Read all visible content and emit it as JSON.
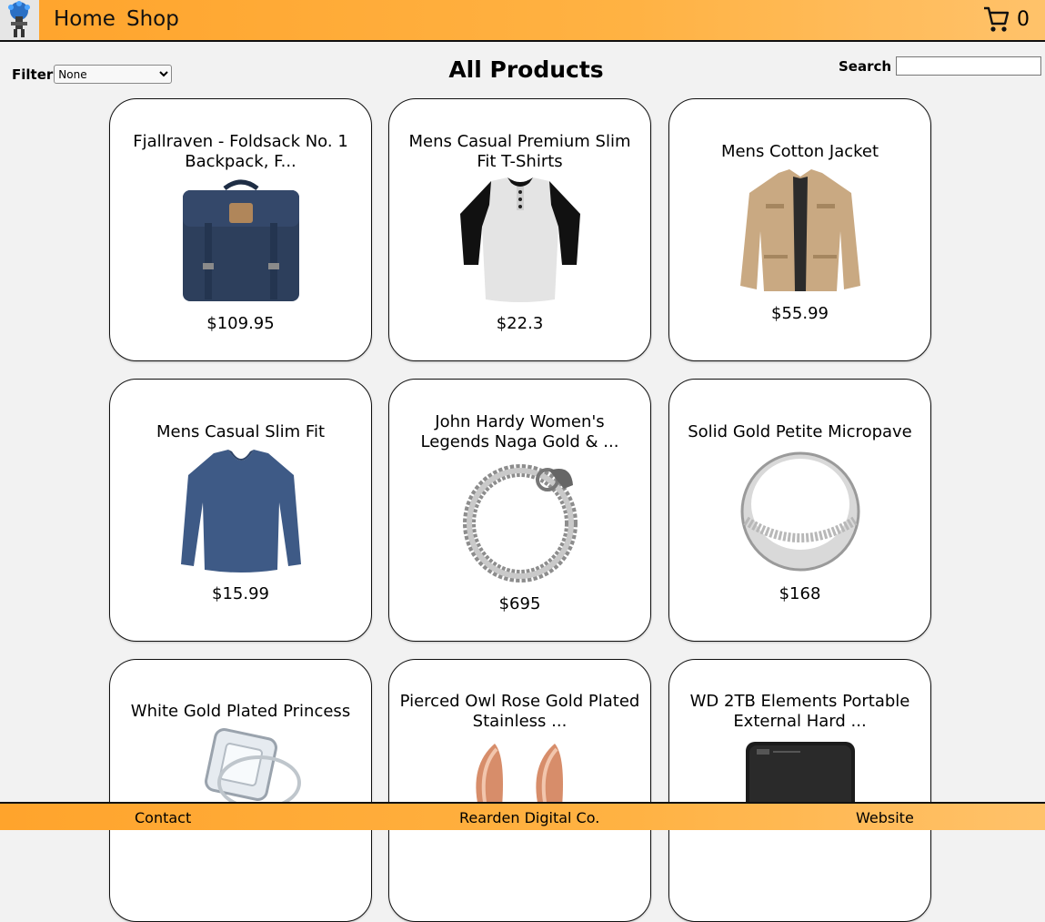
{
  "nav": {
    "home_label": "Home",
    "shop_label": "Shop",
    "cart_count": "0"
  },
  "toolbar": {
    "filter_label": "Filter",
    "filter_selected": "None",
    "page_title": "All Products",
    "search_label": "Search",
    "search_value": ""
  },
  "products": [
    {
      "title": "Fjallraven - Foldsack No. 1 Backpack, F...",
      "price": "$109.95",
      "image": "backpack"
    },
    {
      "title": "Mens Casual Premium Slim Fit T-Shirts",
      "price": "$22.3",
      "image": "tshirt"
    },
    {
      "title": "Mens Cotton Jacket",
      "price": "$55.99",
      "image": "jacket"
    },
    {
      "title": "Mens Casual Slim Fit",
      "price": "$15.99",
      "image": "longsleeve"
    },
    {
      "title": "John Hardy Women's Legends Naga Gold & ...",
      "price": "$695",
      "image": "bracelet"
    },
    {
      "title": "Solid Gold Petite Micropave",
      "price": "$168",
      "image": "ring"
    },
    {
      "title": "White Gold Plated Princess",
      "price": "",
      "image": "diamond-ring"
    },
    {
      "title": "Pierced Owl Rose Gold Plated Stainless ...",
      "price": "",
      "image": "earrings"
    },
    {
      "title": "WD 2TB Elements Portable External Hard ...",
      "price": "",
      "image": "hard-drive"
    }
  ],
  "footer": {
    "contact": "Contact",
    "company": "Rearden Digital Co.",
    "website": "Website"
  },
  "colors": {
    "accent": "#ffa42c",
    "background": "#f2f2f2"
  }
}
